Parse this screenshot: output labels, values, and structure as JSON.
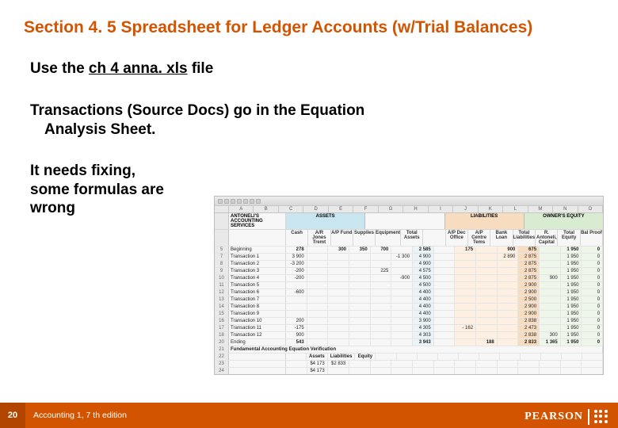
{
  "title": "Section 4. 5 Spreadsheet for Ledger Accounts (w/Trial Balances)",
  "line1_pre": "Use the ",
  "filename": "ch 4 anna. xls",
  "line1_post": " file",
  "line2a": "Transactions (Source Docs) go in the Equation",
  "line2b": "Analysis Sheet.",
  "fix1": "It needs fixing,",
  "fix2": "some formulas are",
  "fix3": "wrong",
  "page": "20",
  "foot": "Accounting 1, 7 th edition",
  "brand": "PEARSON",
  "ss": {
    "company1": "ANTONELI'S",
    "company2": "ACCOUNTING",
    "company3": "SERVICES",
    "sec_assets": "ASSETS",
    "sec_liab": "LIABILITIES",
    "sec_eq": "OWNER'S EQUITY",
    "cols": [
      "A",
      "B",
      "C",
      "D",
      "E",
      "F",
      "G",
      "H",
      "I",
      "J",
      "K",
      "L",
      "M",
      "N",
      "O"
    ],
    "sub_assets": [
      "Cash",
      "A/R Jones Tremt",
      "A/P Fund",
      "Supplies",
      "Equipment",
      "Total Assets"
    ],
    "sub_liab": [
      "A/P Dec Office",
      "A/P Centre Tems",
      "Bank Loan",
      "Total Liabilities"
    ],
    "sub_eq": [
      "R. Antoneli, Capital",
      "Total Equity",
      "Bal Proof"
    ],
    "beginning_label": "Beginning",
    "ending_label": "Ending",
    "bottom_label": "Fundamental Accounting Equation Verification",
    "ver_hdr": [
      "Assets",
      "Liabilities",
      "Equity"
    ],
    "ver_row1": [
      "$4 173",
      "$2 833",
      ""
    ],
    "ver_row2": [
      "$4 173",
      "",
      ""
    ],
    "rows": [
      {
        "n": "5",
        "lbl": "Beginning",
        "cls": "beg",
        "v": [
          "278",
          "",
          "300",
          "350",
          "700",
          "",
          "2 585",
          "",
          "175",
          "",
          "900",
          "675",
          "",
          "1 950",
          "0"
        ]
      },
      {
        "n": "7",
        "lbl": "Transaction 1",
        "v": [
          "3 900",
          "",
          "",
          "",
          "",
          "-1 300",
          "4 900",
          "",
          "",
          "",
          "2 890",
          "2 875",
          "",
          "1 950",
          "0"
        ]
      },
      {
        "n": "8",
        "lbl": "Transaction 2",
        "v": [
          "-3 200",
          "",
          "",
          "",
          "",
          "",
          "4 900",
          "",
          "",
          "",
          "",
          "2 875",
          "",
          "1 950",
          "0"
        ]
      },
      {
        "n": "9",
        "lbl": "Transaction 3",
        "v": [
          "-200",
          "",
          "",
          "",
          "225",
          "",
          "4 575",
          "",
          "",
          "",
          "",
          "2 875",
          "",
          "1 950",
          "0"
        ]
      },
      {
        "n": "10",
        "lbl": "Transaction 4",
        "v": [
          "-200",
          "",
          "",
          "",
          "",
          "-900",
          "4 500",
          "",
          "",
          "",
          "",
          "2 875",
          "900",
          "1 950",
          "0"
        ]
      },
      {
        "n": "11",
        "lbl": "Transaction 5",
        "v": [
          "",
          "",
          "",
          "",
          "",
          "",
          "4 500",
          "",
          "",
          "",
          "",
          "2 900",
          "",
          "1 950",
          "0"
        ]
      },
      {
        "n": "12",
        "lbl": "Transaction 6",
        "v": [
          "-600",
          "",
          "",
          "",
          "",
          "",
          "4 400",
          "",
          "",
          "",
          "",
          "2 900",
          "",
          "1 950",
          "0"
        ]
      },
      {
        "n": "13",
        "lbl": "Transaction 7",
        "v": [
          "",
          "",
          "",
          "",
          "",
          "",
          "4 400",
          "",
          "",
          "",
          "",
          "2 500",
          "",
          "1 950",
          "0"
        ]
      },
      {
        "n": "14",
        "lbl": "Transaction 8",
        "v": [
          "",
          "",
          "",
          "",
          "",
          "",
          "4 400",
          "",
          "",
          "",
          "",
          "2 900",
          "",
          "1 950",
          "0"
        ]
      },
      {
        "n": "15",
        "lbl": "Transaction 9",
        "v": [
          "",
          "",
          "",
          "",
          "",
          "",
          "4 400",
          "",
          "",
          "",
          "",
          "2 900",
          "",
          "1 950",
          "0"
        ]
      },
      {
        "n": "16",
        "lbl": "Transaction 10",
        "v": [
          "200",
          "",
          "",
          "",
          "",
          "",
          "3 900",
          "",
          "",
          "",
          "",
          "2 838",
          "",
          "1 950",
          "0"
        ]
      },
      {
        "n": "17",
        "lbl": "Transaction 11",
        "v": [
          "-175",
          "",
          "",
          "",
          "",
          "",
          "4 305",
          "",
          "- 162",
          "",
          "",
          "2 473",
          "",
          "1 950",
          "0"
        ]
      },
      {
        "n": "18",
        "lbl": "Transaction 12",
        "v": [
          "900",
          "",
          "",
          "",
          "",
          "",
          "4 303",
          "",
          "",
          "",
          "",
          "2 838",
          "300",
          "1 950",
          "0"
        ]
      },
      {
        "n": "20",
        "lbl": "Ending",
        "cls": "end",
        "v": [
          "543",
          "",
          "",
          "",
          "",
          "",
          "3 943",
          "",
          "",
          "188",
          "",
          "2 833",
          "1 365",
          "1 950",
          "0"
        ]
      }
    ]
  }
}
